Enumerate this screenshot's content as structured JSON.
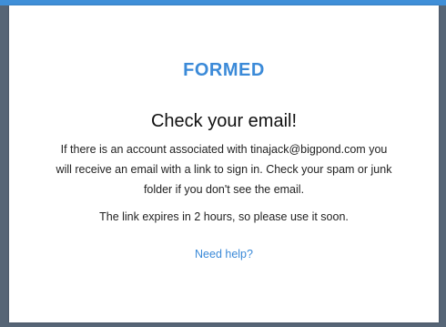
{
  "brand": {
    "logo_text": "FORMED",
    "accent_color": "#3b8ad8"
  },
  "message": {
    "heading": "Check your email!",
    "body_lines": [
      "If there is an account associated with tinajack@bigpond.com you",
      "will receive an email with a link to sign in. Check your spam or junk",
      "folder if you don't see the email."
    ],
    "expiry": "The link expires in 2 hours, so please use it soon."
  },
  "help": {
    "link_text": "Need help?"
  }
}
